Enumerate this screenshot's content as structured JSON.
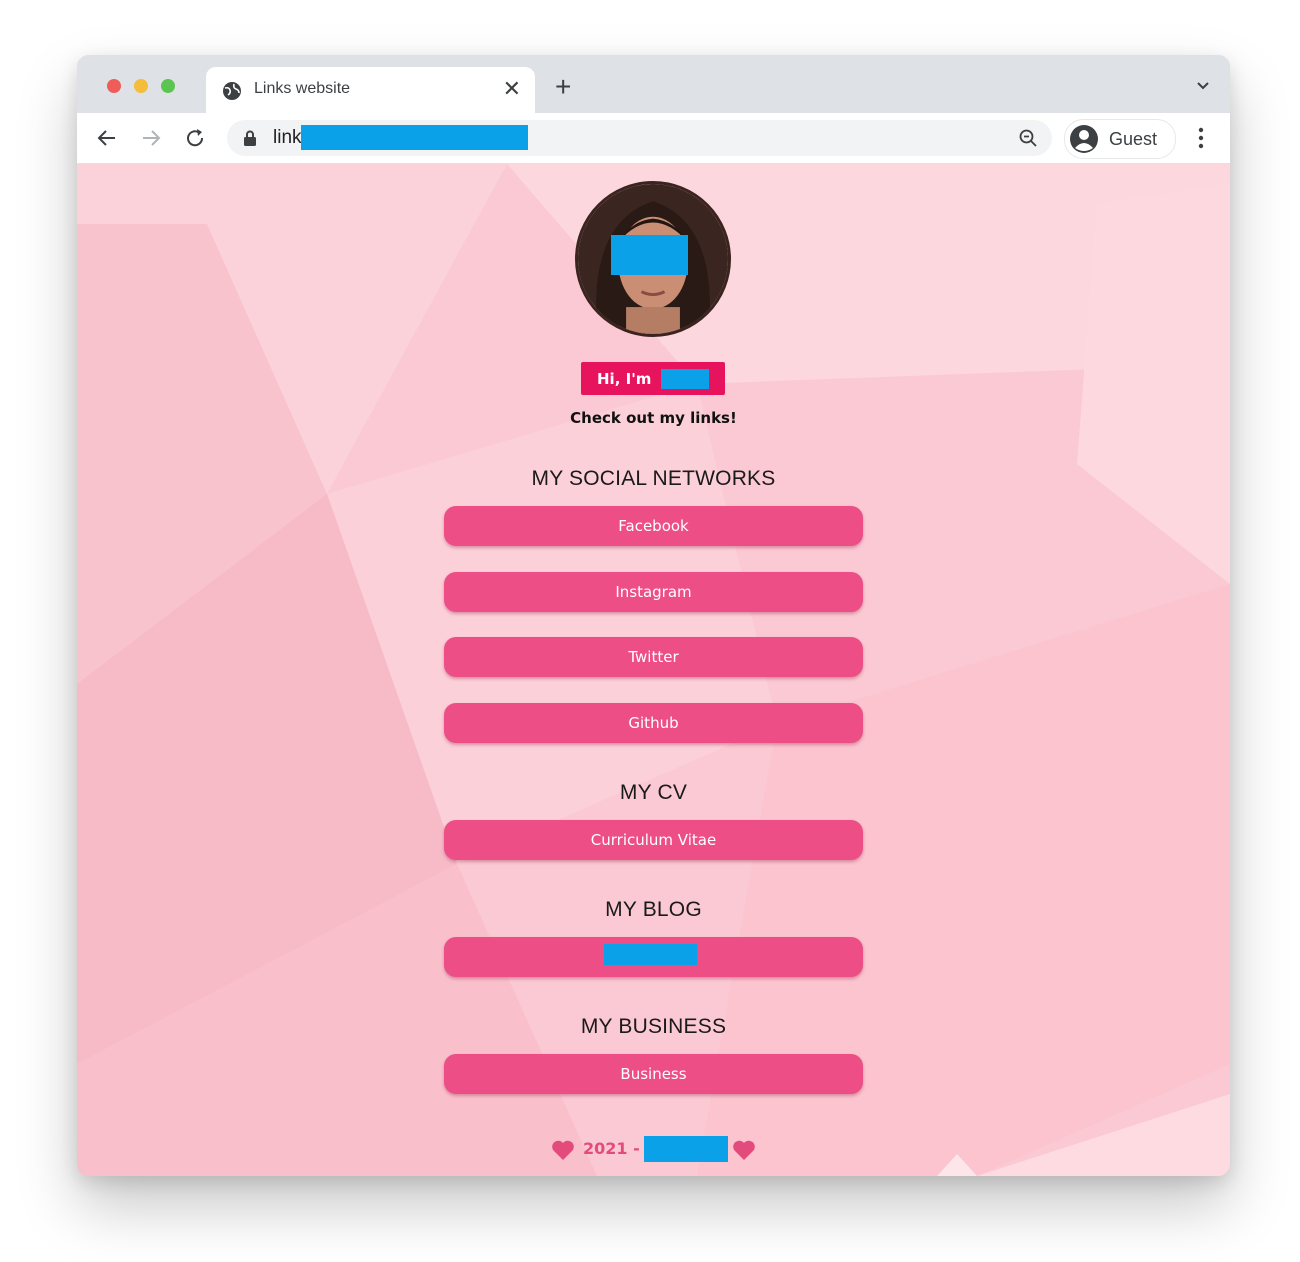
{
  "browser": {
    "tab_title": "Links website",
    "url_visible": "link",
    "profile_label": "Guest"
  },
  "page": {
    "greeting": "Hi, I'm",
    "subtitle": "Check out my links!",
    "sections": {
      "social": {
        "title": "MY SOCIAL NETWORKS",
        "links": [
          "Facebook",
          "Instagram",
          "Twitter",
          "Github"
        ]
      },
      "cv": {
        "title": "MY CV",
        "links": [
          "Curriculum Vitae"
        ]
      },
      "blog": {
        "title": "MY BLOG"
      },
      "business": {
        "title": "MY BUSINESS",
        "links": [
          "Business"
        ]
      }
    },
    "footer_year": "2021 -"
  },
  "colors": {
    "accent": "#ec4e85",
    "greeting_bg": "#e8135d",
    "background": "#fbc9d3",
    "redaction": "#0aa1e8"
  }
}
